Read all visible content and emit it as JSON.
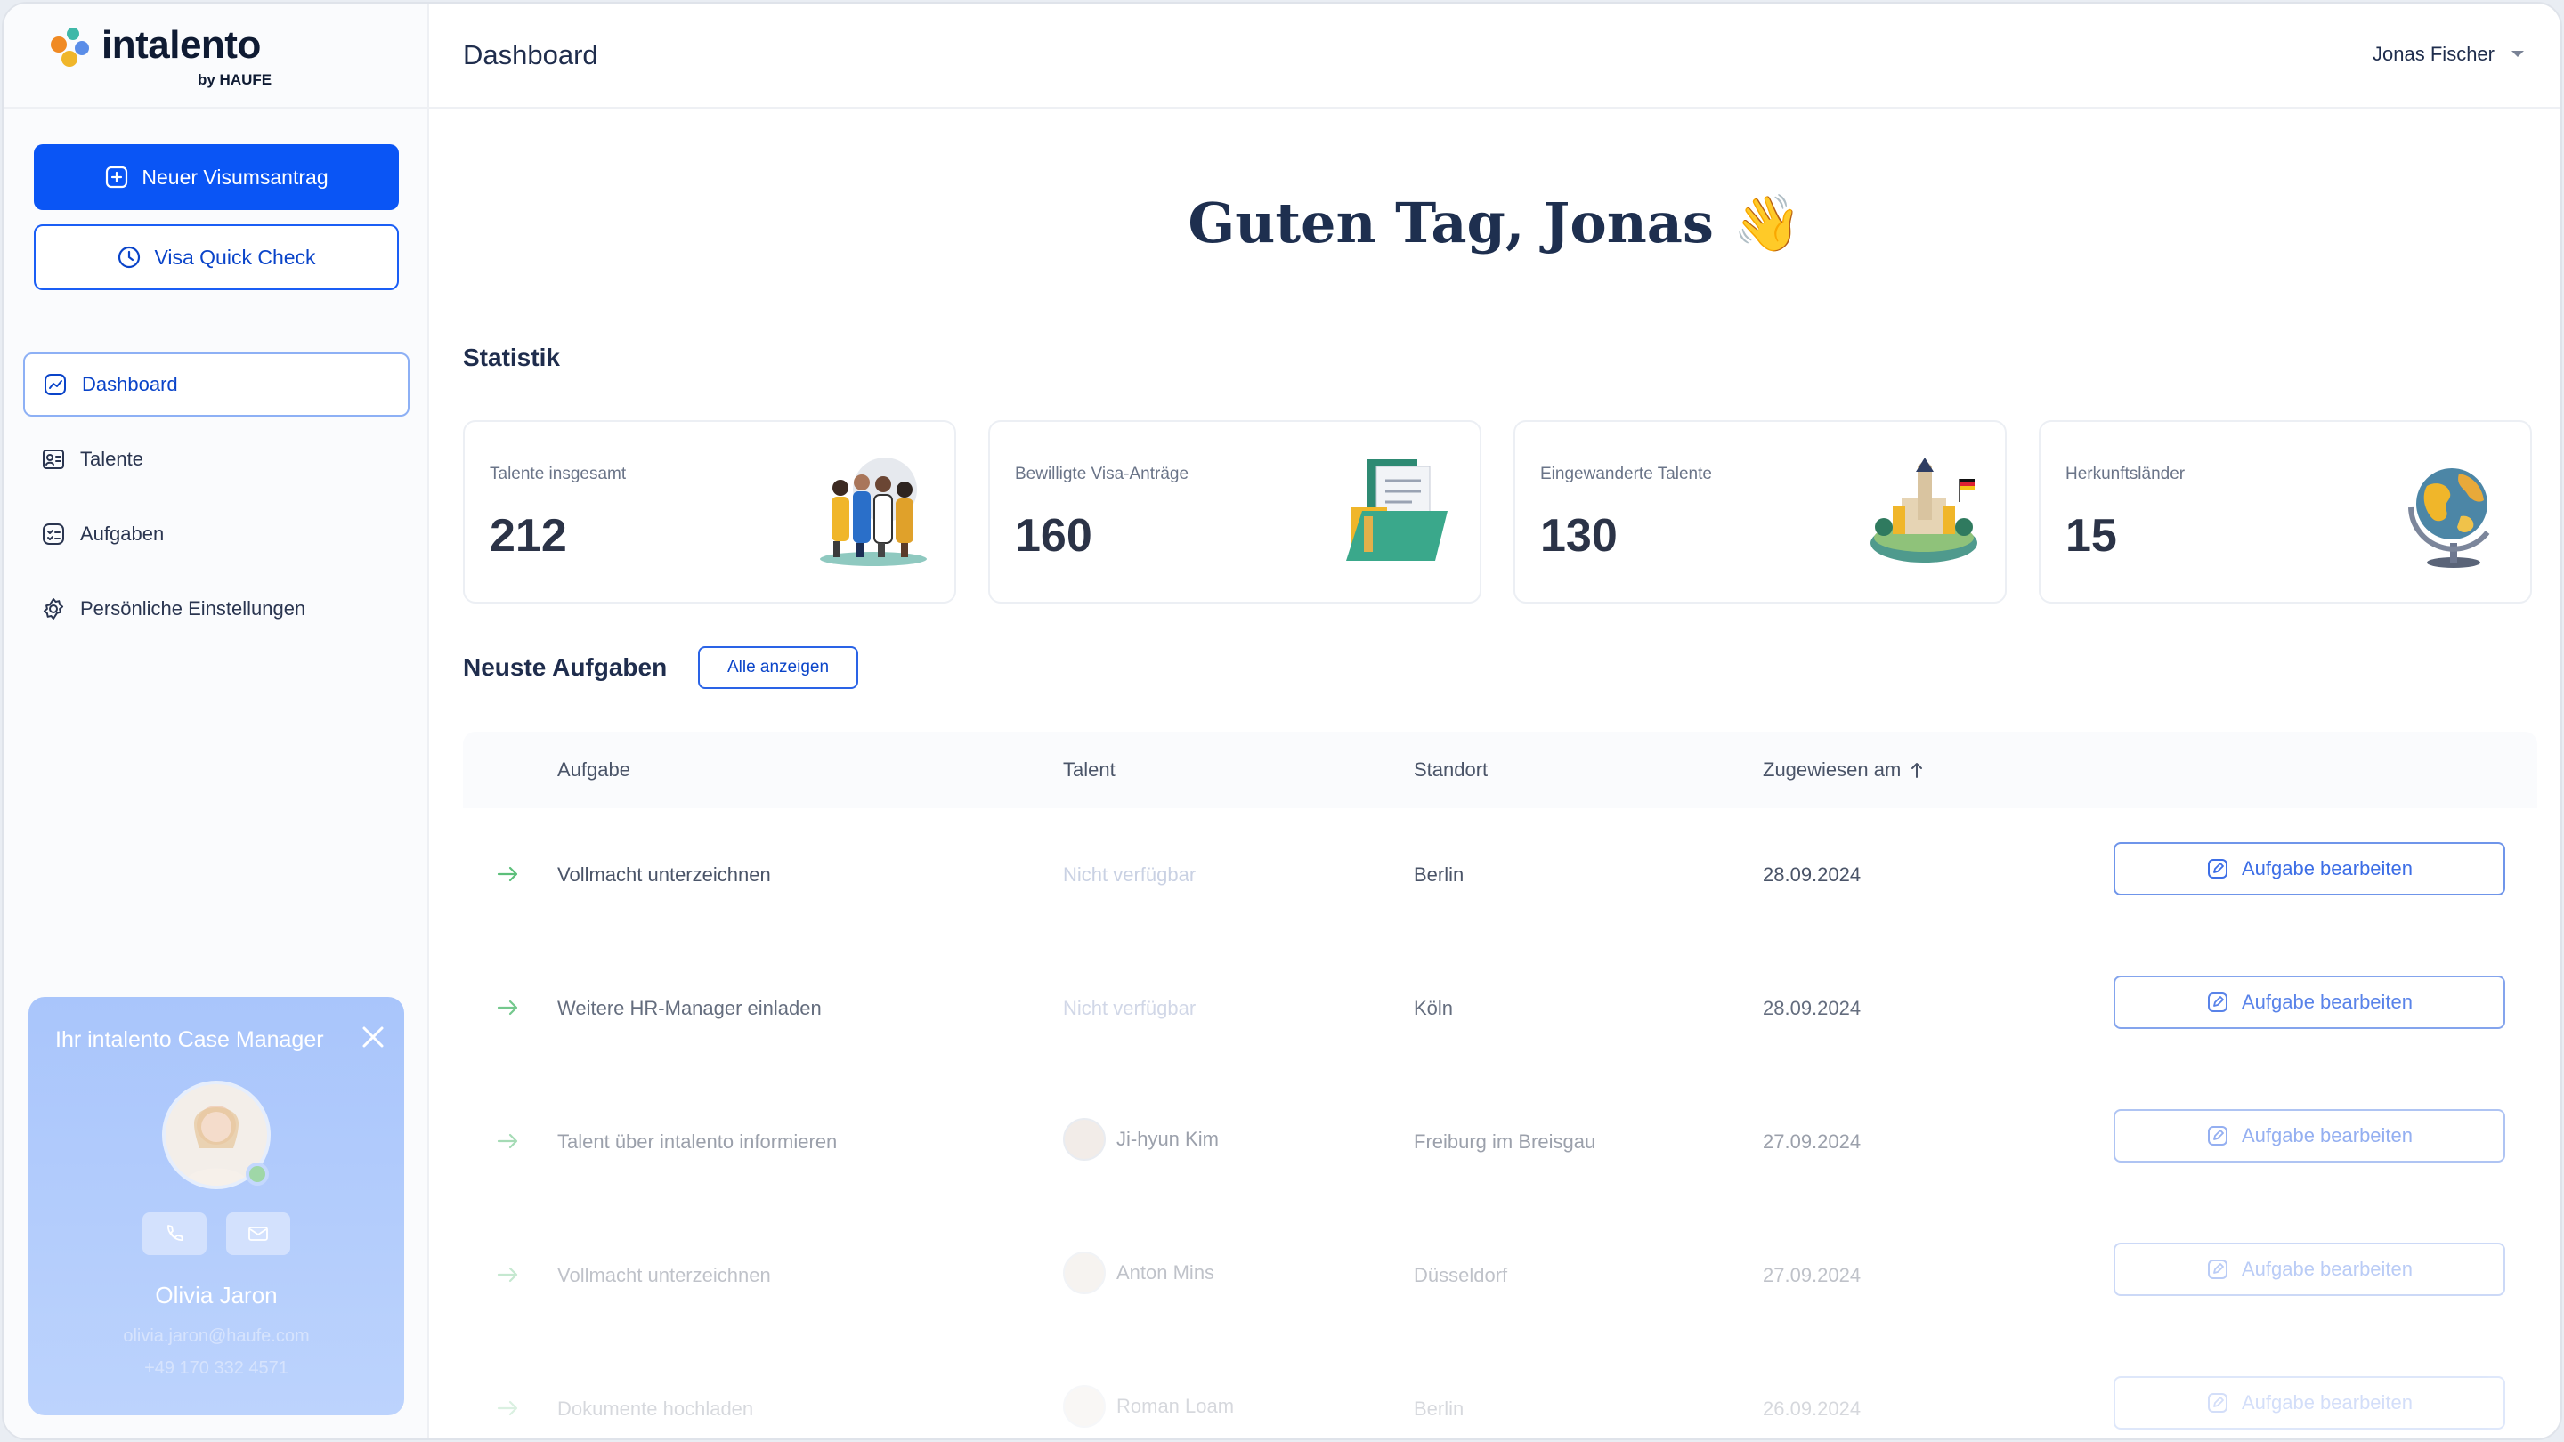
{
  "brand": {
    "name": "intalento",
    "sub": "by HAUFE"
  },
  "sidebar": {
    "new_visa_label": "Neuer Visumsantrag",
    "quick_check_label": "Visa Quick Check",
    "nav": [
      {
        "label": "Dashboard",
        "icon": "chart-icon",
        "active": true
      },
      {
        "label": "Talente",
        "icon": "id-card-icon",
        "active": false
      },
      {
        "label": "Aufgaben",
        "icon": "checklist-icon",
        "active": false
      },
      {
        "label": "Persönliche Einstellungen",
        "icon": "gear-icon",
        "active": false
      }
    ]
  },
  "case_manager": {
    "title": "Ihr intalento Case Manager",
    "name": "Olivia Jaron",
    "email": "olivia.jaron@haufe.com",
    "phone": "+49 170 332 4571"
  },
  "header": {
    "title": "Dashboard",
    "user": "Jonas Fischer"
  },
  "greeting": "Guten Tag, Jonas 👋",
  "stats": {
    "title": "Statistik",
    "cards": [
      {
        "label": "Talente insgesamt",
        "value": "212"
      },
      {
        "label": "Bewilligte Visa-Anträge",
        "value": "160"
      },
      {
        "label": "Eingewanderte Talente",
        "value": "130"
      },
      {
        "label": "Herkunftsländer",
        "value": "15"
      }
    ]
  },
  "tasks": {
    "title": "Neuste Aufgaben",
    "show_all_label": "Alle anzeigen",
    "columns": [
      "Aufgabe",
      "Talent",
      "Standort",
      "Zugewiesen am"
    ],
    "edit_label": "Aufgabe bearbeiten",
    "rows": [
      {
        "task": "Vollmacht unterzeichnen",
        "talent": "Nicht verfügbar",
        "location": "Berlin",
        "date": "28.09.2024"
      },
      {
        "task": "Weitere HR-Manager einladen",
        "talent": "Nicht verfügbar",
        "location": "Köln",
        "date": "28.09.2024"
      },
      {
        "task": "Talent über intalento informieren",
        "talent": "Ji-hyun Kim",
        "location": "Freiburg im Breisgau",
        "date": "27.09.2024"
      },
      {
        "task": "Vollmacht unterzeichnen",
        "talent": "Anton Mins",
        "location": "Düsseldorf",
        "date": "27.09.2024"
      },
      {
        "task": "Dokumente hochladen",
        "talent": "Roman Loam",
        "location": "Berlin",
        "date": "26.09.2024"
      }
    ]
  },
  "colors": {
    "primary": "#0a55f5",
    "success_arrow": "#5cbf7a"
  }
}
